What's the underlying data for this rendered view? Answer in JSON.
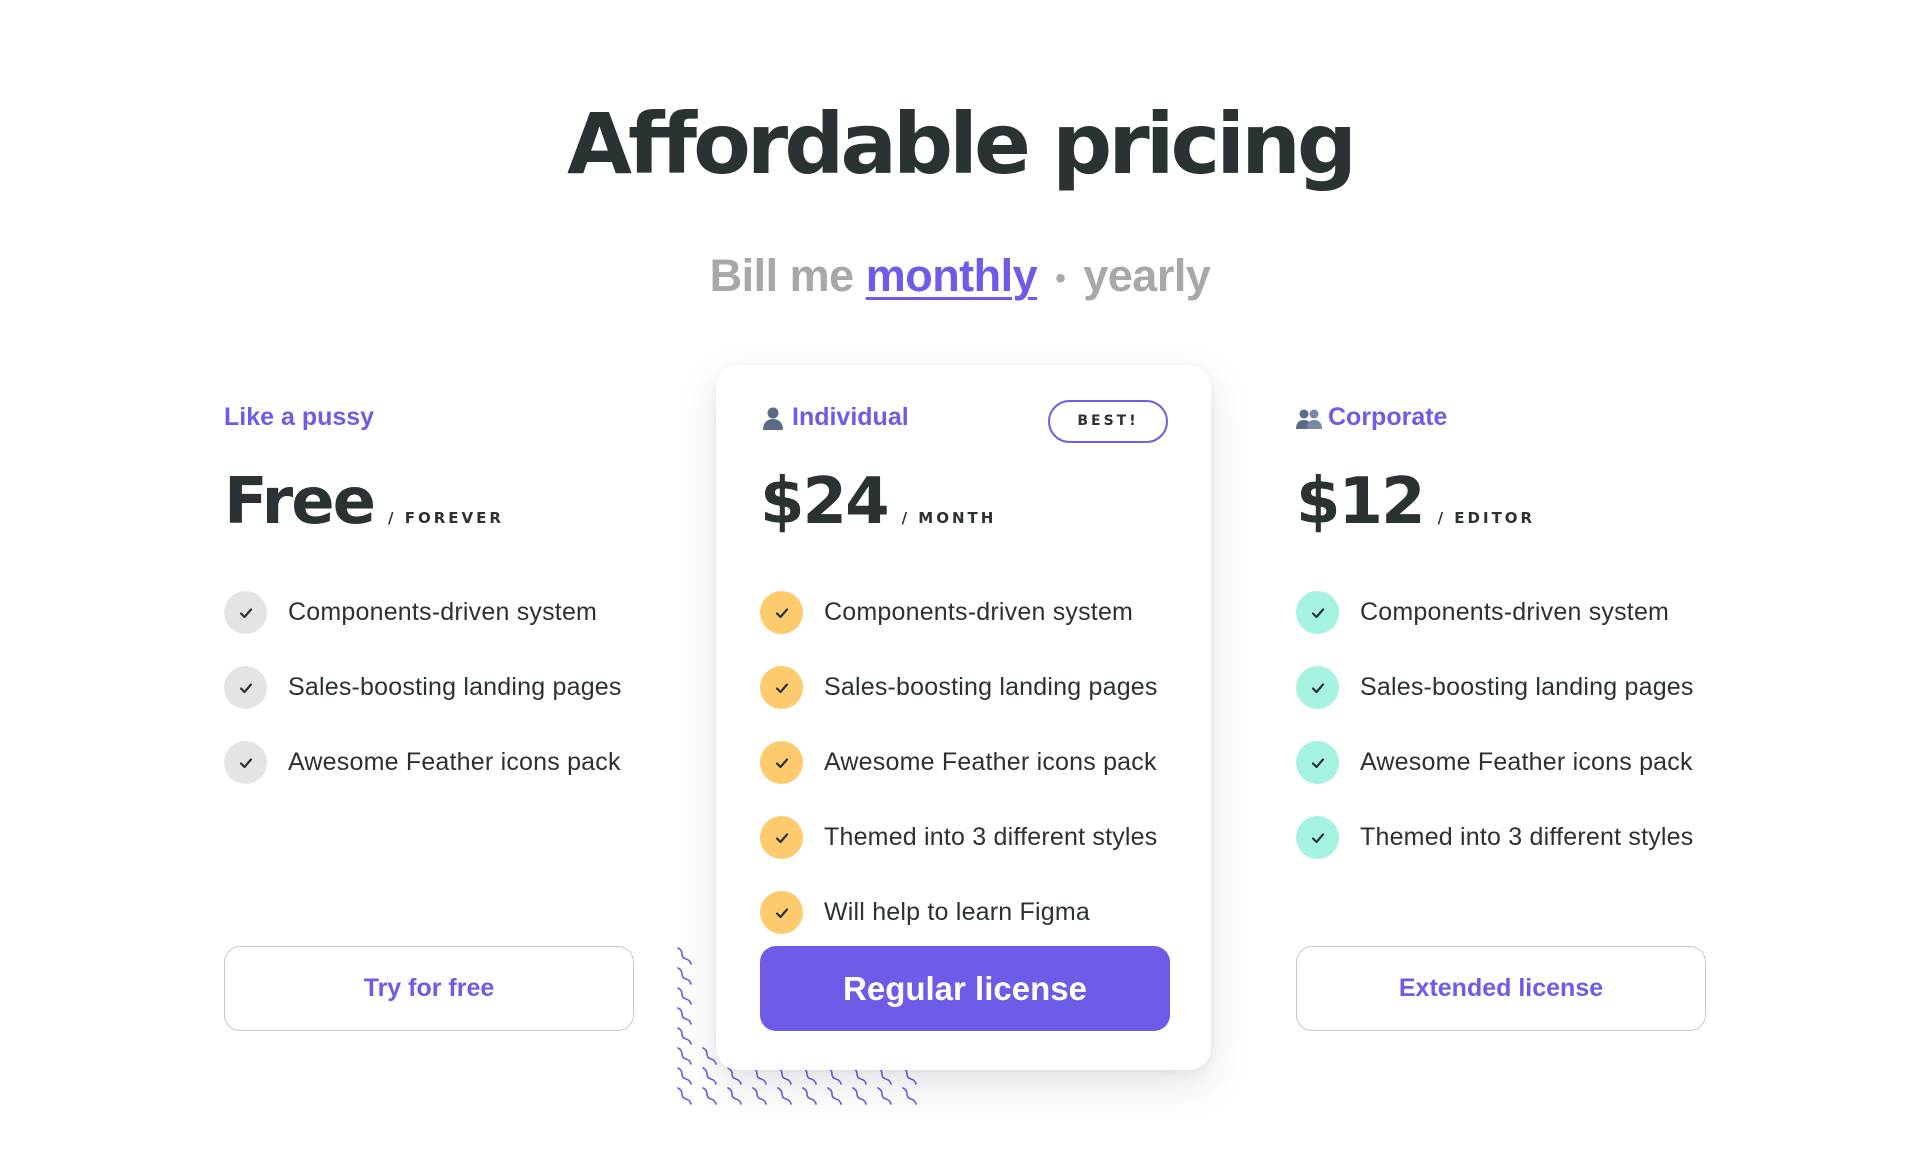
{
  "title": "Affordable pricing",
  "billing": {
    "prefix": "Bill me",
    "options": [
      "monthly",
      "yearly"
    ],
    "selected": "monthly",
    "separator": "•"
  },
  "colors": {
    "accent": "#6c5ce7",
    "dark": "#2b3234",
    "muted": "#a8a8a8",
    "highlight": "#fdcb6e",
    "check_free": "#e4e4e6",
    "check_individual": "#fdcb6e",
    "check_corporate": "#a5f3e0"
  },
  "plans": [
    {
      "name": "Like a pussy",
      "icon": "",
      "price": "Free",
      "period": "/ FOREVER",
      "features": [
        "Components-driven system",
        "Sales-boosting landing pages",
        "Awesome Feather icons pack"
      ],
      "cta": "Try for free",
      "check_color": "#e4e4e6"
    },
    {
      "name": "Individual",
      "icon": "user-icon",
      "badge": "BEST!",
      "price": "$24",
      "period": "/ MONTH",
      "features": [
        "Components-driven system",
        "Sales-boosting landing pages",
        "Awesome Feather icons pack",
        "Themed into 3 different styles",
        "Will help to learn Figma"
      ],
      "cta": "Regular license",
      "check_color": "#fdcb6e"
    },
    {
      "name": "Corporate",
      "icon": "users-icon",
      "price": "$12",
      "period": "/ EDITOR",
      "features": [
        "Components-driven system",
        "Sales-boosting landing pages",
        "Awesome Feather icons pack",
        "Themed into 3 different styles"
      ],
      "cta": "Extended license",
      "check_color": "#a5f3e0"
    }
  ]
}
